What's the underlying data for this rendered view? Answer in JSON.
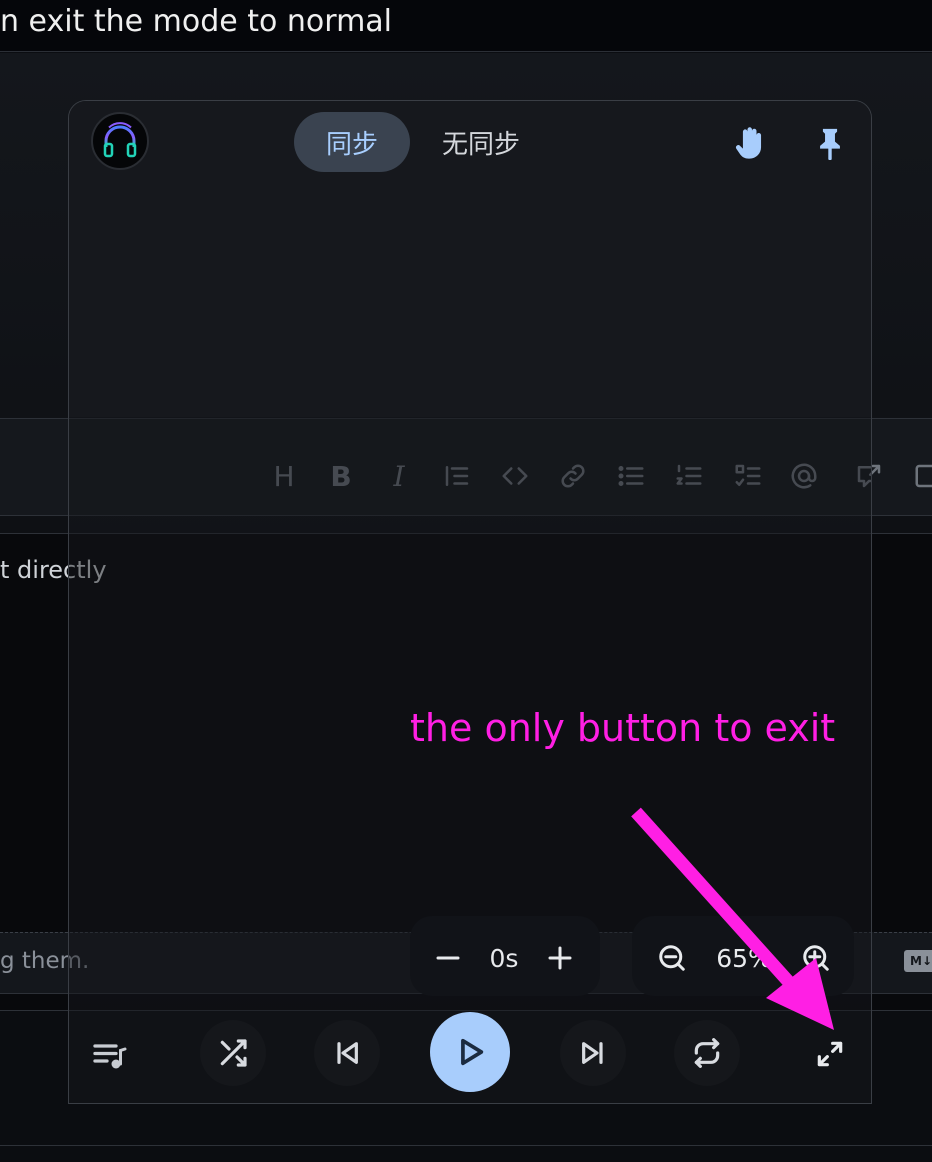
{
  "background": {
    "heading_fragment": "n exit the mode to normal",
    "editor_fragment": "t directly",
    "footer_fragment": "g them.",
    "md_badge": "M↓",
    "toolbar": {
      "heading_label": "H",
      "bold_label": "B",
      "italic_label": "I",
      "icons": [
        "heading-icon",
        "bold-icon",
        "italic-icon",
        "indent-icon",
        "code-icon",
        "link-icon",
        "bullet-list-icon",
        "numbered-list-icon",
        "task-list-icon",
        "mention-icon",
        "reply-icon",
        "image-icon"
      ]
    }
  },
  "player": {
    "tabs": [
      {
        "label": "同步",
        "active": true
      },
      {
        "label": "无同步",
        "active": false
      }
    ],
    "delay": {
      "value": "0s"
    },
    "zoom": {
      "value": "65%"
    },
    "accent_color": "#a8cdfc",
    "icons": [
      "headphones-icon",
      "hand-icon",
      "pin-icon",
      "queue-icon",
      "shuffle-icon",
      "previous-icon",
      "play-icon",
      "next-icon",
      "repeat-icon",
      "fullscreen-exit-icon"
    ]
  },
  "annotation": {
    "text": "the only button to exit",
    "color": "#ff1fe4"
  }
}
